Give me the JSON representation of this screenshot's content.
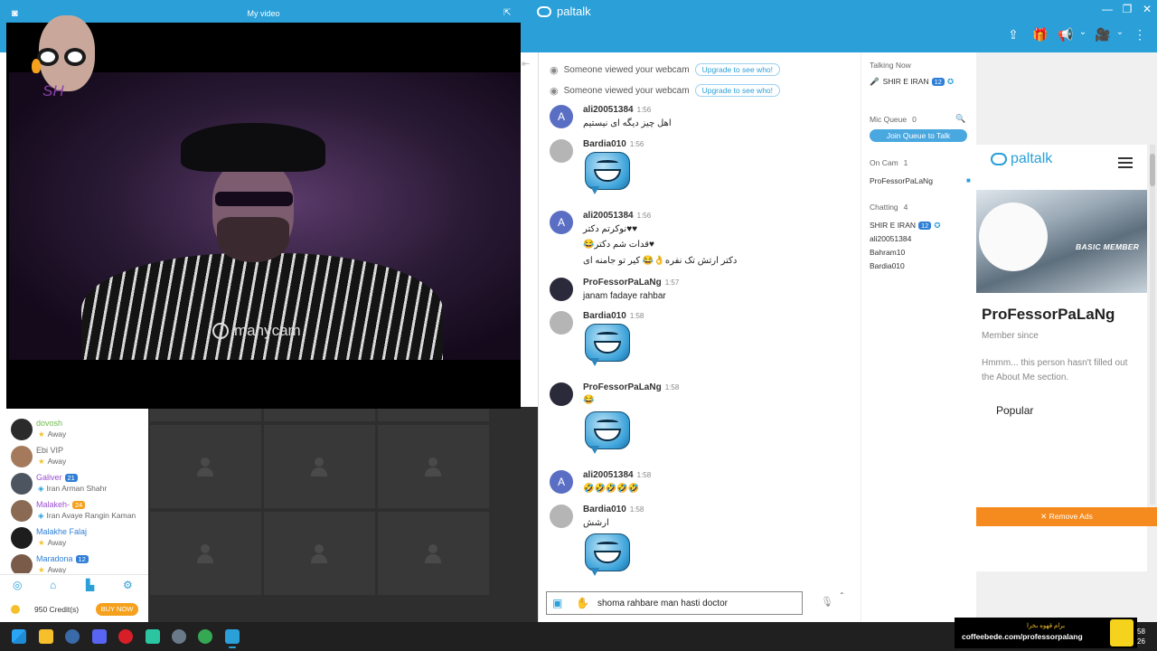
{
  "app": {
    "brand": "paltalk",
    "win_min": "—",
    "win_max": "❐",
    "win_close": "✕",
    "toolbar": {
      "share": "⇪",
      "gift": "🎁",
      "announce": "📢",
      "video": "🎥",
      "more": "⋮",
      "caret": "⌄"
    }
  },
  "my_video": {
    "title": "My video",
    "popout": "⇱",
    "watermark": "manycam",
    "sticker_text": "SH"
  },
  "sidebar": {
    "contacts": [
      {
        "name": "dovosh",
        "status": "Away",
        "name_color": "#6fb94a"
      },
      {
        "name": "Ebi VIP",
        "status": "Away",
        "name_color": "#666666"
      },
      {
        "name": "Galiver",
        "badge": "21",
        "status": "Iran Arman Shahr",
        "status_type": "room",
        "name_color": "#9b4fd1"
      },
      {
        "name": "Malakeh-",
        "badge": "24",
        "status": "Iran Avaye Rangin Kaman",
        "status_type": "room",
        "name_color": "#9b4fd1"
      },
      {
        "name": "Malakhe Falaj",
        "status": "Away",
        "name_color": "#2f7fd6"
      },
      {
        "name": "Maradona",
        "badge": "12",
        "status": "Away",
        "name_color": "#2f7fd6"
      }
    ],
    "nav": {
      "explore": "◎",
      "home": "⌂",
      "stats": "▙",
      "settings": "⚙"
    },
    "credits": "950 Credit(s)",
    "buy_now": "BUY NOW"
  },
  "chat": {
    "system": [
      {
        "text": "Someone viewed your webcam",
        "cta": "Upgrade to see who!"
      },
      {
        "text": "Someone viewed your webcam",
        "cta": "Upgrade to see who!"
      }
    ],
    "messages": [
      {
        "user": "ali20051384",
        "time": "1:56",
        "avatar_letter": "A",
        "lines": [
          "اهل چیز دیگه ای نیستیم"
        ]
      },
      {
        "user": "Bardia010",
        "time": "1:56",
        "lines": []
      },
      {
        "user": "ali20051384",
        "time": "1:56",
        "avatar_letter": "A",
        "lines": [
          "♥♥نوکرتم دکتر",
          "♥قدات شم دکتر😂",
          "دکتر ارتش تک نفره👌😂 کیر تو جامنه ای"
        ]
      },
      {
        "user": "ProFessorPaLaNg",
        "time": "1:57",
        "lines": [
          "janam fadaye rahbar"
        ]
      },
      {
        "user": "Bardia010",
        "time": "1:58",
        "lines": []
      },
      {
        "user": "ProFessorPaLaNg",
        "time": "1:58",
        "lines": [
          "😂"
        ]
      },
      {
        "user": "ali20051384",
        "time": "1:58",
        "avatar_letter": "A",
        "lines": [
          "🤣🤣🤣🤣🤣"
        ]
      },
      {
        "user": "Bardia010",
        "time": "1:58",
        "lines": [
          "ارشش"
        ]
      }
    ],
    "input_value": "shoma rahbare man hasti doctor"
  },
  "users": {
    "talking_now_label": "Talking Now",
    "talking_now_user": "SHIR E IRAN",
    "talking_badge": "12",
    "mic_queue_label": "Mic Queue",
    "mic_queue_count": "0",
    "join_queue": "Join Queue to Talk",
    "on_cam_label": "On Cam",
    "on_cam_count": "1",
    "on_cam_user": "ProFessorPaLaNg",
    "chatting_label": "Chatting",
    "chatting_count": "4",
    "chatting_users": [
      "SHIR E IRAN",
      "ali20051384",
      "Bahram10",
      "Bardia010"
    ]
  },
  "profile": {
    "brand": "paltalk",
    "member_badge": "BASIC MEMBER",
    "name": "ProFessorPaLaNg",
    "member_since": "Member since",
    "about": "Hmmm... this person hasn't filled out the About Me section.",
    "popular": "Popular",
    "remove_ads": "✕ Remove Ads"
  },
  "promo": {
    "line1": "برام قهوه بخرا",
    "line2": "coffeebede.com/professorpalang"
  },
  "clock": {
    "time": "58",
    "date": "26"
  }
}
